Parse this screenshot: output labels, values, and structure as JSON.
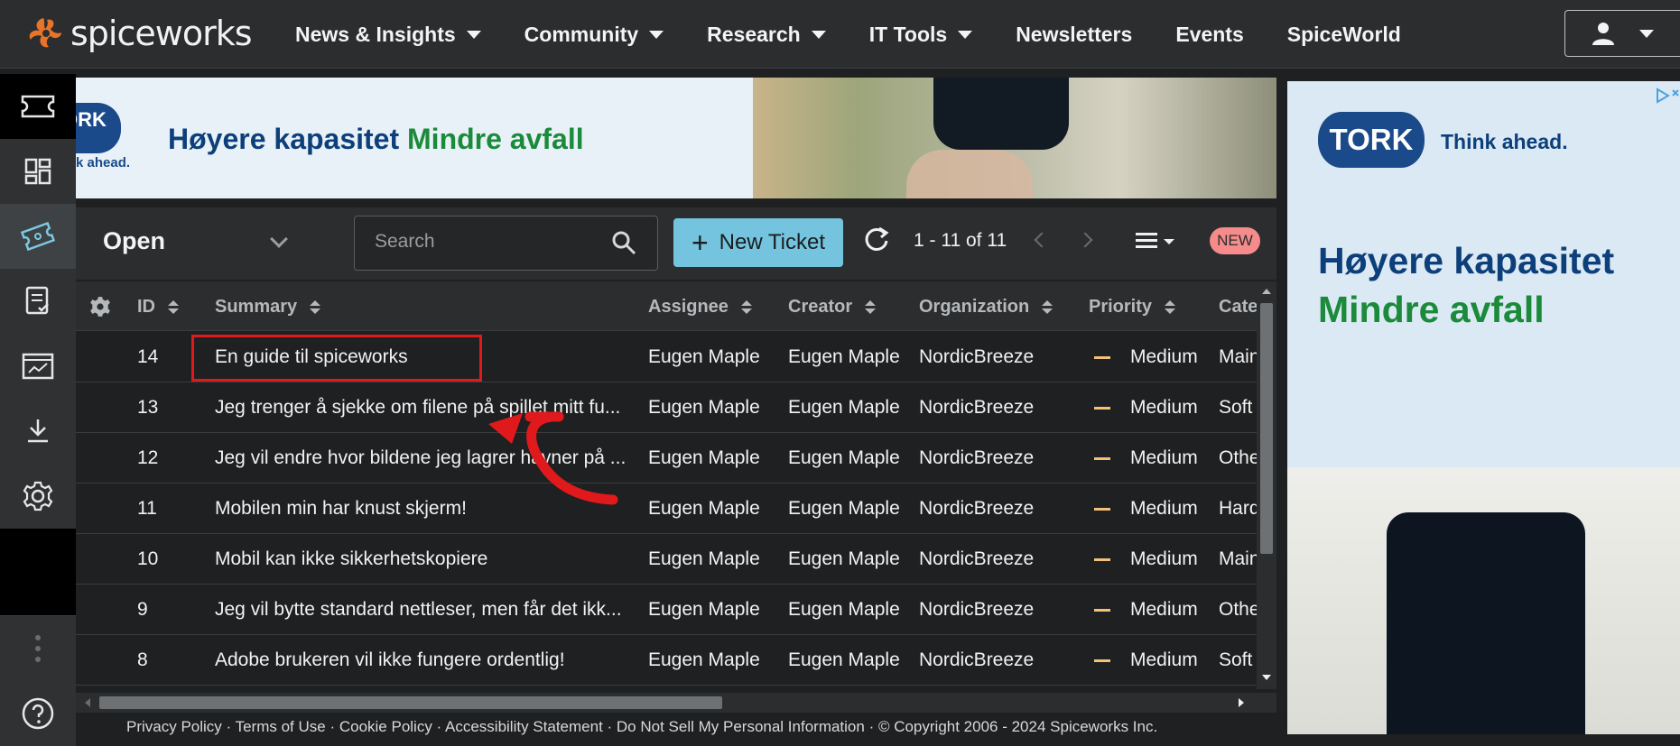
{
  "brand": {
    "logo_text": "spiceworks"
  },
  "nav": {
    "items": [
      {
        "label": "News & Insights",
        "dropdown": true
      },
      {
        "label": "Community",
        "dropdown": true
      },
      {
        "label": "Research",
        "dropdown": true
      },
      {
        "label": "IT Tools",
        "dropdown": true
      },
      {
        "label": "Newsletters",
        "dropdown": false
      },
      {
        "label": "Events",
        "dropdown": false
      },
      {
        "label": "SpiceWorld",
        "dropdown": false
      }
    ]
  },
  "sidebar": {
    "items": [
      {
        "icon": "ticket-icon"
      },
      {
        "icon": "dashboard-icon"
      },
      {
        "icon": "tickets-active-icon"
      },
      {
        "icon": "reports-icon"
      },
      {
        "icon": "analytics-icon"
      },
      {
        "icon": "download-icon"
      },
      {
        "icon": "settings-icon"
      },
      {
        "icon": "more-icon"
      },
      {
        "icon": "help-icon"
      }
    ]
  },
  "banner": {
    "brand": "TORK",
    "sub": "k ahead.",
    "headline_blue": "Høyere kapasitet",
    "headline_green": "Mindre avfall"
  },
  "toolbar": {
    "view_label": "Open",
    "search_placeholder": "Search",
    "new_ticket_label": "New Ticket",
    "page_info": "1 - 11 of 11",
    "new_badge": "NEW"
  },
  "table": {
    "columns": [
      "ID",
      "Summary",
      "Assignee",
      "Creator",
      "Organization",
      "Priority",
      "Cate"
    ],
    "rows": [
      {
        "id": "14",
        "summary": "En guide til spiceworks",
        "assignee": "Eugen Maple",
        "creator": "Eugen Maple",
        "org": "NordicBreeze",
        "priority": "Medium",
        "category": "Main"
      },
      {
        "id": "13",
        "summary": "Jeg trenger å sjekke om filene på spillet mitt fu...",
        "assignee": "Eugen Maple",
        "creator": "Eugen Maple",
        "org": "NordicBreeze",
        "priority": "Medium",
        "category": "Soft"
      },
      {
        "id": "12",
        "summary": "Jeg vil endre hvor bildene jeg lagrer havner på ...",
        "assignee": "Eugen Maple",
        "creator": "Eugen Maple",
        "org": "NordicBreeze",
        "priority": "Medium",
        "category": "Othe"
      },
      {
        "id": "11",
        "summary": "Mobilen min har knust skjerm!",
        "assignee": "Eugen Maple",
        "creator": "Eugen Maple",
        "org": "NordicBreeze",
        "priority": "Medium",
        "category": "Hard"
      },
      {
        "id": "10",
        "summary": "Mobil kan ikke sikkerhetskopiere",
        "assignee": "Eugen Maple",
        "creator": "Eugen Maple",
        "org": "NordicBreeze",
        "priority": "Medium",
        "category": "Main"
      },
      {
        "id": "9",
        "summary": "Jeg vil bytte standard nettleser, men får det ikk...",
        "assignee": "Eugen Maple",
        "creator": "Eugen Maple",
        "org": "NordicBreeze",
        "priority": "Medium",
        "category": "Othe"
      },
      {
        "id": "8",
        "summary": "Adobe brukeren vil ikke fungere ordentlig!",
        "assignee": "Eugen Maple",
        "creator": "Eugen Maple",
        "org": "NordicBreeze",
        "priority": "Medium",
        "category": "Soft"
      }
    ]
  },
  "footer": {
    "text": "Privacy Policy · Terms of Use · Cookie Policy · Accessibility Statement · Do Not Sell My Personal Information · © Copyright 2006 - 2024 Spiceworks Inc."
  },
  "ad": {
    "brand": "TORK",
    "tagline": "Think ahead.",
    "headline_blue": "Høyere kapasitet",
    "headline_green": "Mindre avfall"
  },
  "colors": {
    "accent": "#74c4e0",
    "highlight_box": "#e0191c",
    "priority_medium": "#f2c27a",
    "badge_new": "#f58b8b"
  }
}
